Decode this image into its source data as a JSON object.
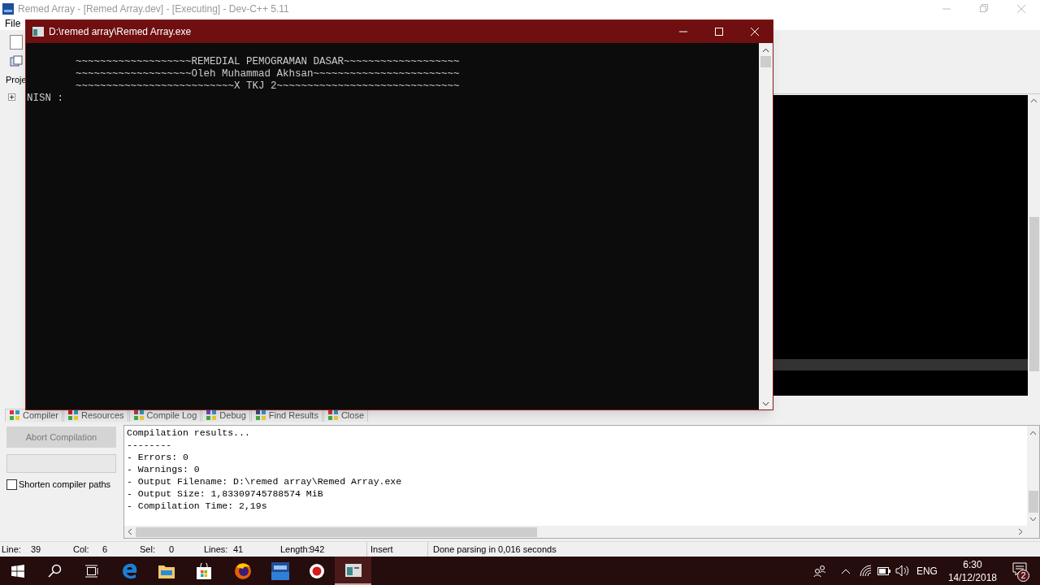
{
  "ide": {
    "title": "Remed Array - [Remed Array.dev] - [Executing] - Dev-C++ 5.11",
    "menu": [
      "File"
    ],
    "project_tab": "Proje",
    "bottom_tabs": [
      "Compiler",
      "Resources",
      "Compile Log",
      "Debug",
      "Find Results",
      "Close"
    ],
    "abort_button": {
      "label": "Abort Compilation",
      "disabled": true
    },
    "shorten_paths": {
      "label": "Shorten compiler paths",
      "checked": false
    },
    "log_lines": [
      "Compilation results...",
      "--------",
      "- Errors: 0",
      "- Warnings: 0",
      "- Output Filename: D:\\remed array\\Remed Array.exe",
      "- Output Size: 1,83309745788574 MiB",
      "- Compilation Time: 2,19s"
    ],
    "status_bar": [
      {
        "label": "Line:",
        "value": "39"
      },
      {
        "label": "Col:",
        "value": "6"
      },
      {
        "label": "Sel:",
        "value": "0"
      },
      {
        "label": "Lines:",
        "value": "41"
      },
      {
        "label": "Length:",
        "value": "942"
      },
      {
        "label": "Insert"
      },
      {
        "label": "Done parsing in 0,016 seconds"
      }
    ]
  },
  "console": {
    "title": "D:\\remed array\\Remed Array.exe",
    "lines": [
      "        ~~~~~~~~~~~~~~~~~~~REMEDIAL PEMOGRAMAN DASAR~~~~~~~~~~~~~~~~~~~",
      "        ~~~~~~~~~~~~~~~~~~~Oleh Muhammad Akhsan~~~~~~~~~~~~~~~~~~~~~~~~",
      "        ~~~~~~~~~~~~~~~~~~~~~~~~~~X TKJ 2~~~~~~~~~~~~~~~~~~~~~~~~~~~~~~",
      "NISN : "
    ]
  },
  "taskbar": {
    "language": "ENG",
    "time": "6:30",
    "date": "14/12/2018",
    "notifications": "2"
  }
}
